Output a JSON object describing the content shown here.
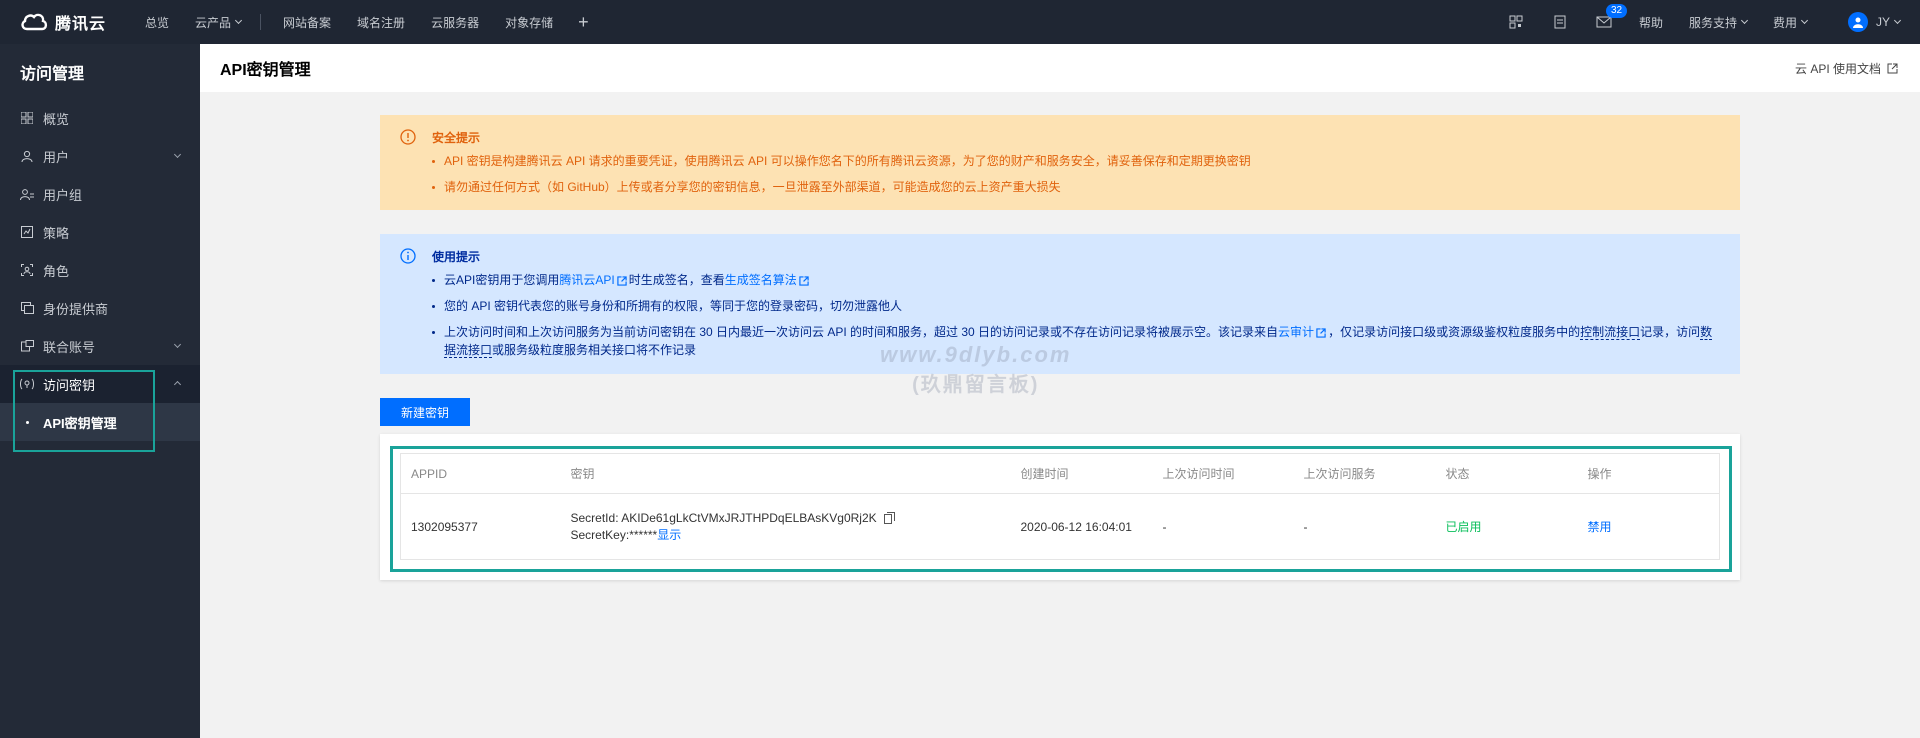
{
  "topbar": {
    "brand": "腾讯云",
    "nav": [
      "总览",
      "云产品",
      "网站备案",
      "域名注册",
      "云服务器",
      "对象存储"
    ],
    "mail_badge": "32",
    "help": "帮助",
    "support": "服务支持",
    "billing": "费用",
    "user": "JY"
  },
  "sidebar": {
    "title": "访问管理",
    "items": [
      "概览",
      "用户",
      "用户组",
      "策略",
      "角色",
      "身份提供商",
      "联合账号",
      "访问密钥"
    ],
    "sub_item": "API密钥管理"
  },
  "header": {
    "title": "API密钥管理",
    "doc_link": "云 API 使用文档"
  },
  "security_tip": {
    "title": "安全提示",
    "items": [
      "API 密钥是构建腾讯云 API 请求的重要凭证，使用腾讯云 API 可以操作您名下的所有腾讯云资源，为了您的财产和服务安全，请妥善保存和定期更换密钥",
      "请勿通过任何方式（如 GitHub）上传或者分享您的密钥信息，一旦泄露至外部渠道，可能造成您的云上资产重大损失"
    ]
  },
  "usage_tip": {
    "title": "使用提示",
    "item1_a": "云API密钥用于您调用",
    "item1_link1": "腾讯云API",
    "item1_b": "时生成签名，查看",
    "item1_link2": "生成签名算法",
    "item2": "您的 API 密钥代表您的账号身份和所拥有的权限，等同于您的登录密码，切勿泄露他人",
    "item3_a": "上次访问时间和上次访问服务为当前访问密钥在 30 日内最近一次访问云 API 的时间和服务，超过 30 日的访问记录或不存在访问记录将被展示空。该记录来自",
    "item3_link": "云审计",
    "item3_b": "，仅记录访问接口级或资源级鉴权粒度服务中的",
    "item3_dotted1": "控制流接口",
    "item3_c": "记录，访问",
    "item3_dotted2": "数据流接口",
    "item3_d": "或服务级粒度服务相关接口将不作记录"
  },
  "create_button": "新建密钥",
  "table": {
    "columns": [
      "APPID",
      "密钥",
      "创建时间",
      "上次访问时间",
      "上次访问服务",
      "状态",
      "操作"
    ],
    "row": {
      "appid": "1302095377",
      "secret_id_label": "SecretId:",
      "secret_id": "AKIDe61gLkCtVMxJRJTHPDqELBAsKVg0Rj2K",
      "secret_key_label": "SecretKey:",
      "secret_key": "******",
      "show": "显示",
      "created": "2020-06-12 16:04:01",
      "last_access": "-",
      "last_service": "-",
      "status": "已启用",
      "action": "禁用"
    }
  },
  "watermark": {
    "line1": "www.9dlyb.com",
    "line2": "(玖鼎留言板)"
  }
}
